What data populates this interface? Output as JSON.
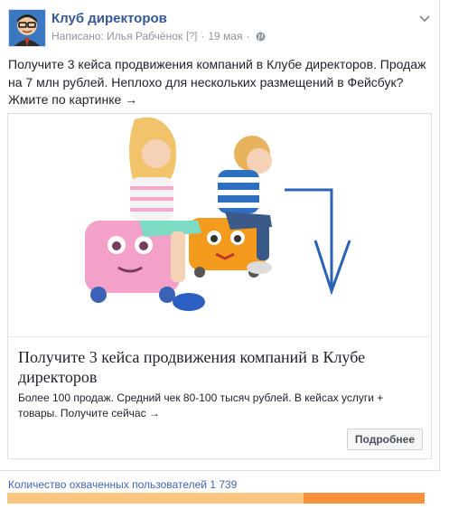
{
  "post": {
    "page_name": "Клуб директоров",
    "written_by": "Написано: Илья Рабчёнок",
    "help_mark": "[?]",
    "separator": "·",
    "date": "19 мая",
    "separator2": "·",
    "privacy_icon": "globe-icon",
    "menu_icon": "chevron-down-icon",
    "text": "Получите 3 кейса продвижения компаний в Клубе директоров. Продаж на 7 млн рублей. Неплохо для нескольких размещений в Фейсбук? Жмите по картинке →"
  },
  "card": {
    "image_alt": "children-on-ride-on-suitcases",
    "title": "Получите 3 кейса продвижения компаний в Клубе директоров",
    "description": "Более 100 продаж. Средний чек 80-100 тысяч рублей. В кейсах услуги + товары. Получите сейчас →",
    "cta_label": "Подробнее"
  },
  "reach": {
    "label": "Количество охваченных пользователей 1 739",
    "fill_fraction": 0.71
  },
  "colors": {
    "link": "#365899",
    "reach_text": "#4267b2",
    "bar_dark": "#f7923a",
    "bar_light": "#fbc682",
    "arrow": "#2b62b6"
  }
}
